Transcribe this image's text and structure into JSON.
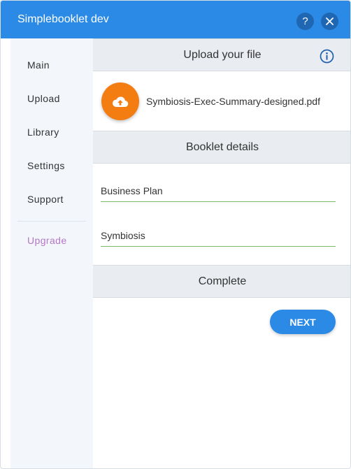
{
  "window": {
    "title": "Simplebooklet dev"
  },
  "titlebar": {
    "help_label": "?",
    "close_label": "×"
  },
  "sidebar": {
    "items": [
      {
        "label": "Main"
      },
      {
        "label": "Upload"
      },
      {
        "label": "Library"
      },
      {
        "label": "Settings"
      },
      {
        "label": "Support"
      }
    ],
    "upgrade_label": "Upgrade"
  },
  "main": {
    "upload_section": {
      "title": "Upload your file",
      "file_name": "Symbiosis-Exec-Summary-designed.pdf"
    },
    "details_section": {
      "title": "Booklet details",
      "category_value": "Business Plan",
      "name_value": "Symbiosis"
    },
    "complete_section": {
      "title": "Complete"
    },
    "next_label": "NEXT"
  },
  "colors": {
    "accent": "#2b8ae6",
    "upload_button": "#f47d12",
    "upgrade_text": "#b476c7",
    "field_underline": "#7ab86a"
  },
  "icons": [
    "help-icon",
    "close-icon",
    "info-icon",
    "cloud-upload-icon"
  ]
}
